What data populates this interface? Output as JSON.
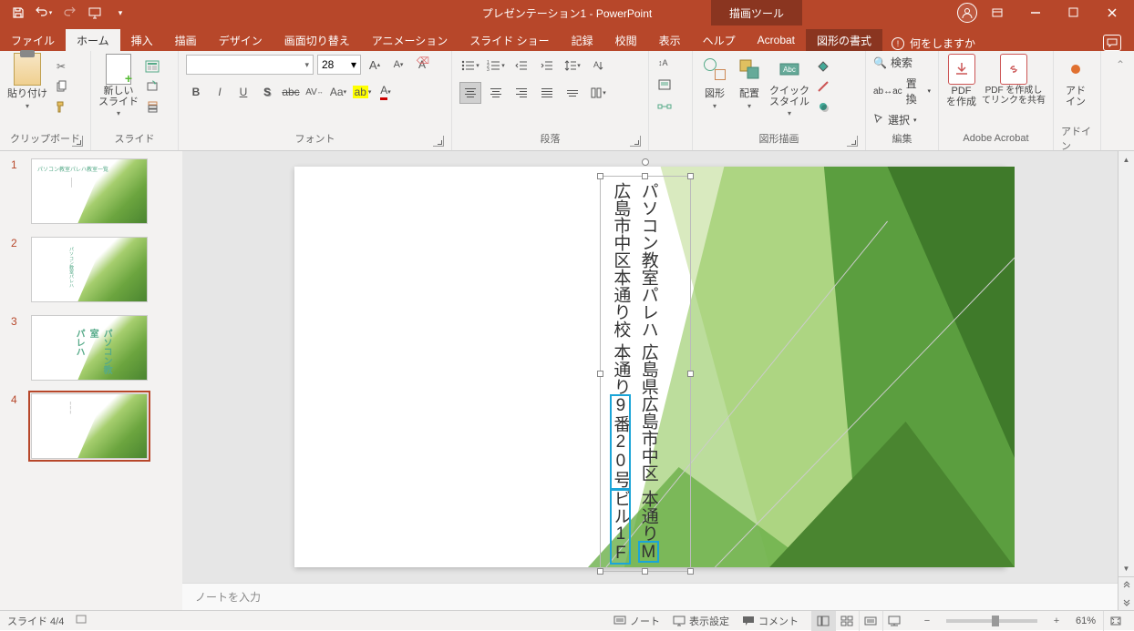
{
  "title": "プレゼンテーション1 - PowerPoint",
  "context_tool": "描画ツール",
  "tabs": {
    "file": "ファイル",
    "home": "ホーム",
    "insert": "挿入",
    "draw": "描画",
    "design": "デザイン",
    "transitions": "画面切り替え",
    "animations": "アニメーション",
    "slideshow": "スライド ショー",
    "record": "記録",
    "review": "校閲",
    "view": "表示",
    "help": "ヘルプ",
    "acrobat": "Acrobat",
    "format": "図形の書式"
  },
  "tell_me": "何をしますか",
  "ribbon": {
    "clipboard": {
      "label": "クリップボード",
      "paste": "貼り付け"
    },
    "slides": {
      "label": "スライド",
      "new_slide": "新しい\nスライド"
    },
    "font": {
      "label": "フォント",
      "size": "28",
      "name": ""
    },
    "paragraph": {
      "label": "段落"
    },
    "drawing": {
      "label": "図形描画",
      "shapes": "図形",
      "arrange": "配置",
      "quick_styles": "クイック\nスタイル"
    },
    "editing": {
      "label": "編集",
      "find": "検索",
      "replace": "置換",
      "select": "選択"
    },
    "acrobat": {
      "label": "Adobe Acrobat",
      "create": "PDF\nを作成",
      "share": "PDF を作成し\nてリンクを共有"
    },
    "addins": {
      "label": "アドイン",
      "btn": "アド\nイン"
    }
  },
  "slide_text": {
    "line1": "パソコン教室パレハ広島市中区本通り校",
    "line2_a": "広島県広島市中区本通り",
    "line2_b": "9番20号",
    "line3_a": "本通り",
    "line3_b": "Mビル1F"
  },
  "thumb3": "パソコン教室\nパレハ",
  "thumb1_title": "パソコン教室パレハ教室一覧",
  "thumb2_title": "パソコン教室パレハ",
  "notes_placeholder": "ノートを入力",
  "status": {
    "slide_num": "スライド 4/4",
    "notes": "ノート",
    "display": "表示設定",
    "comments": "コメント",
    "zoom": "61%"
  }
}
